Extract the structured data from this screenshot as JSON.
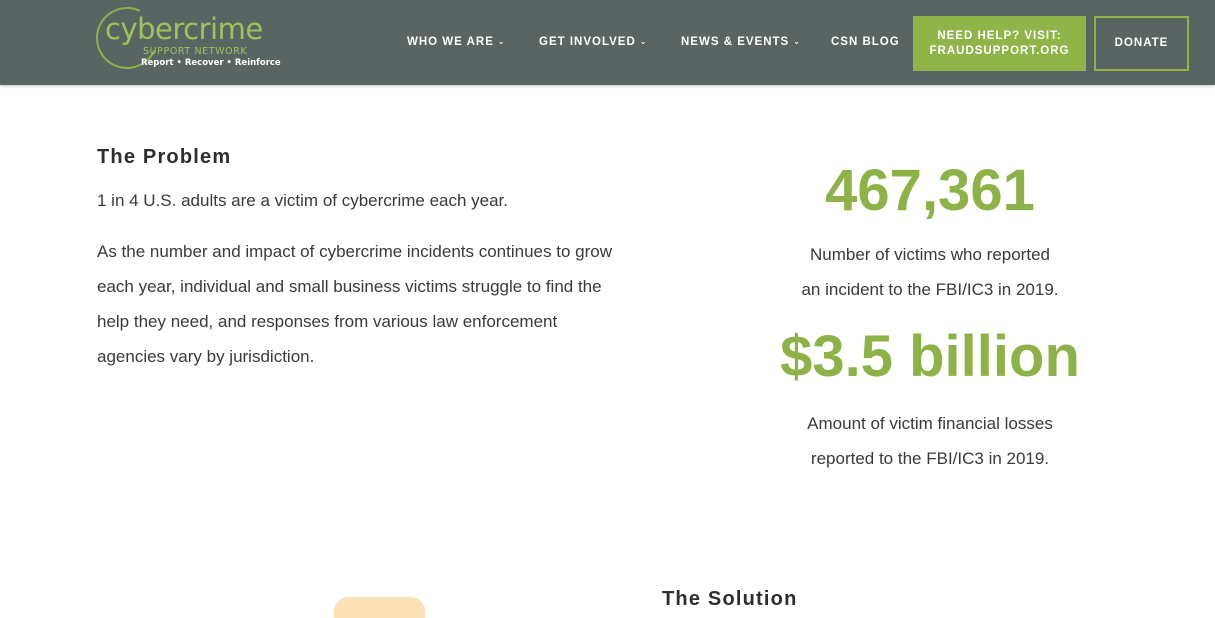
{
  "header": {
    "logo": {
      "title": "cybercrime",
      "subtitle": "SUPPORT NETWORK",
      "tagline": "Report • Recover • Reinforce"
    },
    "nav": [
      {
        "label": "WHO WE ARE",
        "has_dropdown": true
      },
      {
        "label": "GET INVOLVED",
        "has_dropdown": true
      },
      {
        "label": "NEWS & EVENTS",
        "has_dropdown": true
      },
      {
        "label": "CSN BLOG",
        "has_dropdown": false
      }
    ],
    "help_button": {
      "line1": "NEED HELP? VISIT:",
      "line2": "FRAUDSUPPORT.ORG"
    },
    "donate_button": "DONATE"
  },
  "problem": {
    "heading": "The Problem",
    "lead": "1 in 4 U.S. adults are a victim of cybercrime each year.",
    "body": "As the number and impact of cybercrime incidents continues to grow each year, individual and small business victims struggle to find the help they need, and responses from various law enforcement agencies vary by jurisdiction."
  },
  "stats": [
    {
      "number": "467,361",
      "desc_line1": "Number of victims who reported",
      "desc_line2": "an incident to the FBI/IC3 in 2019."
    },
    {
      "number": "$3.5 billion",
      "desc_line1": "Amount of victim financial losses",
      "desc_line2": "reported to the FBI/IC3 in 2019."
    }
  ],
  "solution": {
    "heading": "The Solution"
  },
  "colors": {
    "header_bg": "#5a6462",
    "accent_green": "#8db247",
    "illustration_peach": "#fbe0b8"
  }
}
